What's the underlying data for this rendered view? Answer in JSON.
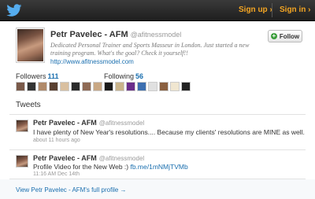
{
  "topbar": {
    "signup_label": "Sign up ›",
    "signin_label": "Sign in ›",
    "logo_icon": "twitter-bird-icon",
    "logo_color": "#55acee",
    "link_color": "#f5a623"
  },
  "profile": {
    "name": "Petr Pavelec - AFM",
    "handle": "@afitnessmodel",
    "bio": "Dedicated Personal Trainer and Sports Masseur in London. Just started a new training program. What's the goal? Check it yourself!!",
    "url": "http://www.afitnessmodel.com",
    "follow_label": "Follow"
  },
  "stats": {
    "followers_label": "Followers",
    "followers_count": "111",
    "following_label": "Following",
    "following_count": "56",
    "followers_thumb_colors": [
      "#7a5a4a",
      "#333333",
      "#b08a6a",
      "#5a4030",
      "#d9c0a0",
      "#2b2b2b",
      "#8f6b55",
      "#c9a884"
    ],
    "following_thumb_colors": [
      "#1a1a1a",
      "#c9b38a",
      "#6a2d8a",
      "#3d6fb0",
      "#e0e0e0",
      "#8a6040",
      "#f0e6d0",
      "#222222"
    ]
  },
  "tweets_heading": "Tweets",
  "tweets": [
    {
      "author": "Petr Pavelec - AFM",
      "handle": "@afitnessmodel",
      "text": "I have plenty of New Year's resolutions.... Because my clients' resolutions are MINE as well.",
      "link": "",
      "time": "about 11 hours ago"
    },
    {
      "author": "Petr Pavelec - AFM",
      "handle": "@afitnessmodel",
      "text": "Profile Video for the New Web :) ",
      "link": "fb.me/1mNMjTVMb",
      "time": "11:16 AM Dec 14th"
    }
  ],
  "footer": {
    "full_profile_label": "View Petr Pavelec - AFM's full profile →"
  }
}
